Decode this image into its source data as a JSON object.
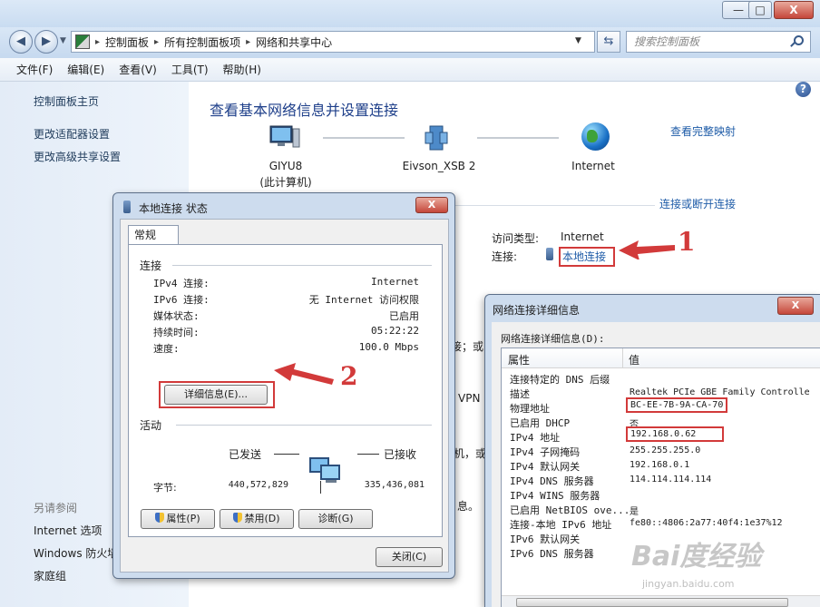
{
  "window": {
    "min_label": "—",
    "max_label": "□",
    "close_label": "X"
  },
  "address": {
    "crumbs": [
      "控制面板",
      "所有控制面板项",
      "网络和共享中心"
    ],
    "search_placeholder": "搜索控制面板"
  },
  "menu": [
    "文件(F)",
    "编辑(E)",
    "查看(V)",
    "工具(T)",
    "帮助(H)"
  ],
  "left_pane": {
    "home": "控制面板主页",
    "links": [
      "更改适配器设置",
      "更改高级共享设置"
    ],
    "see_also_title": "另请参阅",
    "see_also": [
      "Internet 选项",
      "Windows 防火墙",
      "家庭组"
    ]
  },
  "main": {
    "title": "查看基本网络信息并设置连接",
    "view_full_map": "查看完整映射",
    "connect_disconnect": "连接或断开连接",
    "nodes": [
      {
        "name": "GIYU8",
        "sub": "(此计算机)"
      },
      {
        "name": "Eivson_XSB  2",
        "sub": ""
      },
      {
        "name": "Internet",
        "sub": ""
      }
    ],
    "access_type_label": "访问类型:",
    "access_type_value": "Internet",
    "connection_label": "连接:",
    "connection_value": "本地连接",
    "fragments": [
      "接；或",
      "VPN",
      "机，或",
      "息。"
    ]
  },
  "status_dialog": {
    "title": "本地连接 状态",
    "tab": "常规",
    "connection_group": "连接",
    "rows": [
      {
        "label": "IPv4 连接:",
        "value": "Internet"
      },
      {
        "label": "IPv6 连接:",
        "value": "无 Internet 访问权限"
      },
      {
        "label": "媒体状态:",
        "value": "已启用"
      },
      {
        "label": "持续时间:",
        "value": "05:22:22"
      },
      {
        "label": "速度:",
        "value": "100.0 Mbps"
      }
    ],
    "details_button": "详细信息(E)...",
    "activity_group": "活动",
    "sent_label": "已发送",
    "received_label": "已接收",
    "bytes_label": "字节:",
    "bytes_sent": "440,572,829",
    "bytes_received": "335,436,081",
    "buttons": [
      "属性(P)",
      "禁用(D)",
      "诊断(G)"
    ],
    "close_button": "关闭(C)"
  },
  "details_dialog": {
    "title": "网络连接详细信息",
    "caption": "网络连接详细信息(D):",
    "col_property": "属性",
    "col_value": "值",
    "rows": [
      {
        "prop": "连接特定的 DNS 后缀",
        "val": ""
      },
      {
        "prop": "描述",
        "val": "Realtek PCIe GBE Family Controlle"
      },
      {
        "prop": "物理地址",
        "val": "BC-EE-7B-9A-CA-70"
      },
      {
        "prop": "已启用 DHCP",
        "val": "否"
      },
      {
        "prop": "IPv4 地址",
        "val": "192.168.0.62"
      },
      {
        "prop": "IPv4 子网掩码",
        "val": "255.255.255.0"
      },
      {
        "prop": "IPv4 默认网关",
        "val": "192.168.0.1"
      },
      {
        "prop": "IPv4 DNS 服务器",
        "val": "114.114.114.114"
      },
      {
        "prop": "IPv4 WINS 服务器",
        "val": ""
      },
      {
        "prop": "已启用 NetBIOS ove...",
        "val": "是"
      },
      {
        "prop": "连接-本地 IPv6 地址",
        "val": "fe80::4806:2a77:40f4:1e37%12"
      },
      {
        "prop": "IPv6 默认网关",
        "val": ""
      },
      {
        "prop": "IPv6 DNS 服务器",
        "val": ""
      }
    ]
  },
  "annotations": {
    "one": "1",
    "two": "2"
  },
  "watermark": {
    "main": "Bai度经验",
    "sub": "jingyan.baidu.com"
  },
  "colors": {
    "accent_red": "#d23a3a",
    "link_blue": "#1f5ca8",
    "title_blue": "#1e3f8a"
  }
}
